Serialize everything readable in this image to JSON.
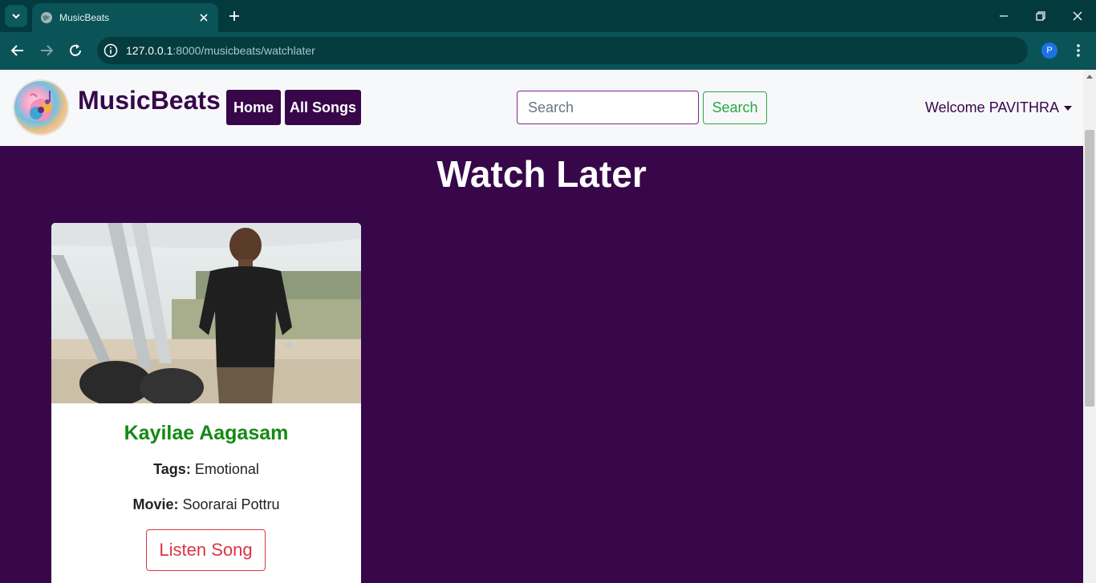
{
  "browser": {
    "tab_title": "MusicBeats",
    "url_host": "127.0.0.1",
    "url_rest": ":8000/musicbeats/watchlater",
    "profile_initial": "P"
  },
  "navbar": {
    "brand": "MusicBeats",
    "links": [
      {
        "label": "Home"
      },
      {
        "label": "All Songs"
      }
    ],
    "search_placeholder": "Search",
    "search_button": "Search",
    "welcome": "Welcome PAVITHRA"
  },
  "page": {
    "heading": "Watch Later"
  },
  "songs": [
    {
      "title": "Kayilae Aagasam",
      "tags_label": "Tags:",
      "tags_value": " Emotional",
      "movie_label": "Movie:",
      "movie_value": " Soorarai Pottru",
      "button": "Listen Song"
    }
  ],
  "colors": {
    "page_bg": "#37074a",
    "brand": "#37074a",
    "title_green": "#138a13",
    "search_green": "#28a745",
    "listen_red": "#dc3545"
  }
}
